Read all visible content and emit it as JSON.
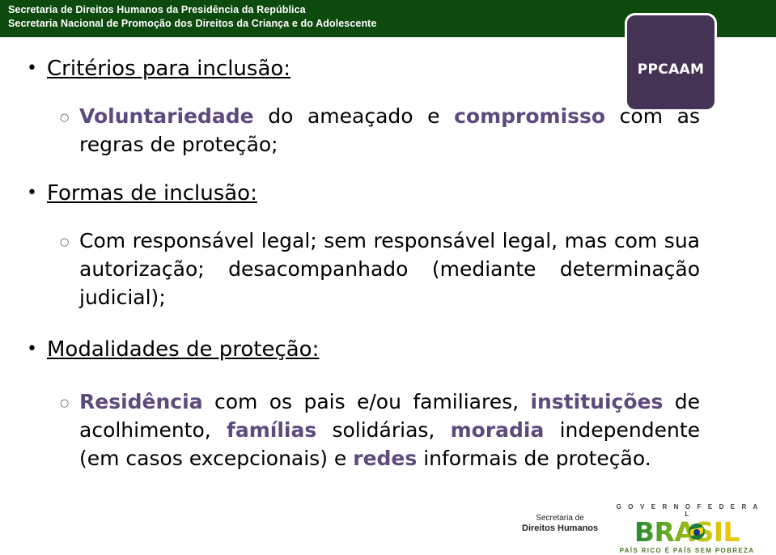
{
  "header": {
    "line1": "Secretaria de Direitos Humanos da Presidência da República",
    "line2": "Secretaria Nacional de Promoção dos Direitos da Criança e do Adolescente",
    "band_color": "#0d4a0d",
    "text_color": "#ffffff"
  },
  "logo": {
    "label": "PPCAAM",
    "fill_color": "#453355",
    "border_color": "#ffffff"
  },
  "bullets": {
    "level1_glyph": "•",
    "level2_glyph": "○"
  },
  "accent_color": "#5d4a7e",
  "sections": [
    {
      "heading": "Critérios para inclusão:",
      "item": {
        "parts": [
          {
            "text": "Voluntariedade",
            "highlight": true
          },
          {
            "text": " do ameaçado e ",
            "highlight": false
          },
          {
            "text": "compromisso",
            "highlight": true
          },
          {
            "text": " com as regras de proteção;",
            "highlight": false
          }
        ]
      }
    },
    {
      "heading": "Formas de inclusão:",
      "item": {
        "parts": [
          {
            "text": "Com responsável legal; sem responsável legal, mas com sua autorização; desacompanhado (mediante determinação judicial);",
            "highlight": false
          }
        ]
      }
    },
    {
      "heading": "Modalidades de proteção:",
      "item": {
        "parts": [
          {
            "text": "Residência",
            "highlight": true
          },
          {
            "text": " com os pais e/ou familiares, ",
            "highlight": false
          },
          {
            "text": "instituições",
            "highlight": true
          },
          {
            "text": " de acolhimento, ",
            "highlight": false
          },
          {
            "text": "famílias",
            "highlight": true
          },
          {
            "text": " solidárias, ",
            "highlight": false
          },
          {
            "text": "moradia",
            "highlight": true
          },
          {
            "text": " independente (em casos excepcionais) e ",
            "highlight": false
          },
          {
            "text": "redes",
            "highlight": true
          },
          {
            "text": " informais de proteção.",
            "highlight": false
          }
        ]
      }
    }
  ],
  "footer": {
    "sdh": {
      "line1": "Secretaria de",
      "line2": "Direitos Humanos"
    },
    "brasil": {
      "government": "G O V E R N O    F E D E R A L",
      "wordmark": "BRASIL",
      "tagline": "PAÍS RICO É PAÍS SEM POBREZA"
    }
  }
}
